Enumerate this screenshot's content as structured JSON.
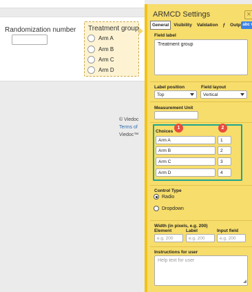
{
  "form": {
    "randomization_label": "Randomization number",
    "treatment_label": "Treatment group",
    "arms": [
      "Arm A",
      "Arm B",
      "Arm C",
      "Arm D"
    ]
  },
  "footer": {
    "line1": "© Viedoc",
    "line2": "Terms of",
    "line3": "Viedoc™"
  },
  "dialog": {
    "title": "ARMCD Settings",
    "close_glyph": "×",
    "tabs": [
      "General",
      "Visibility",
      "Validation",
      "ƒ",
      "Output"
    ],
    "tab_abc": "abc ▾",
    "field_label_heading": "Field label",
    "field_label_value": "Treatment group",
    "label_position_heading": "Label position",
    "label_position_value": "Top",
    "field_layout_heading": "Field layout",
    "field_layout_value": "Vertical",
    "measurement_unit_heading": "Measurement Unit",
    "measurement_unit_value": "",
    "choices_heading": "Choices",
    "choices": [
      {
        "label": "Arm A",
        "code": "1"
      },
      {
        "label": "Arm B",
        "code": "2"
      },
      {
        "label": "Arm C",
        "code": "3"
      },
      {
        "label": "Arm D",
        "code": "4"
      }
    ],
    "badge_1": "1",
    "badge_2": "2",
    "control_type_heading": "Control Type",
    "control_options": [
      {
        "label": "Radio",
        "selected": true
      },
      {
        "label": "Dropdown",
        "selected": false
      }
    ],
    "width_heading": "Width (in pixels, e.g. 200)",
    "width_cols": [
      "Element",
      "Label",
      "Input field"
    ],
    "width_placeholder": "e.g. 200",
    "instructions_heading": "Instructions for user",
    "instructions_placeholder": "Help text for user"
  },
  "colors": {
    "dialog_bg": "#f7dd6b",
    "highlight": "#1ca58f",
    "badge": "#e74c3c",
    "tab_accent": "#3b82e8"
  }
}
